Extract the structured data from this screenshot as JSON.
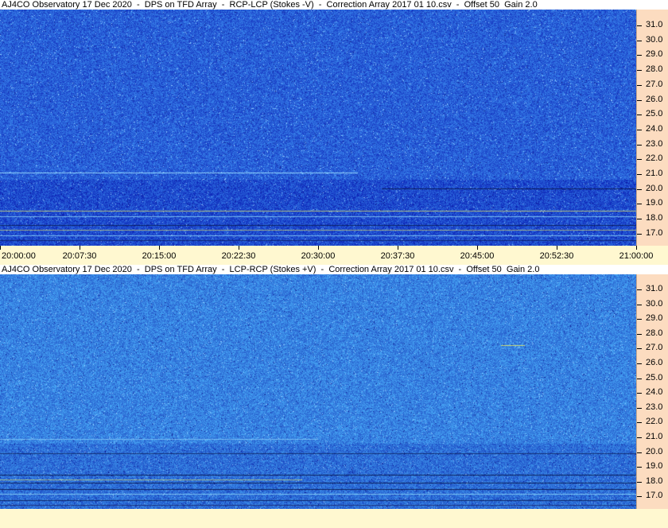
{
  "panels": [
    {
      "title": "AJ4CO Observatory 17 Dec 2020  -  DPS on TFD Array  -  RCP-LCP (Stokes -V)  -  Correction Array 2017 01 10.csv  -  Offset 50  Gain 2.0",
      "freq_labels": [
        "31.0",
        "30.0",
        "29.0",
        "28.0",
        "27.0",
        "26.0",
        "25.0",
        "24.0",
        "23.0",
        "22.0",
        "21.0",
        "20.0",
        "19.0",
        "18.0",
        "17.0"
      ]
    },
    {
      "title": "AJ4CO Observatory 17 Dec 2020  -  DPS on TFD Array  -  LCP-RCP (Stokes +V)  -  Correction Array 2017 01 10.csv  -  Offset 50  Gain 2.0",
      "freq_labels": [
        "31.0",
        "30.0",
        "29.0",
        "28.0",
        "27.0",
        "26.0",
        "25.0",
        "24.0",
        "23.0",
        "22.0",
        "21.0",
        "20.0",
        "19.0",
        "18.0",
        "17.0"
      ]
    }
  ],
  "time_axis": {
    "labels": [
      "20:00:00",
      "20:07:30",
      "20:15:00",
      "20:22:30",
      "20:30:00",
      "20:37:30",
      "20:45:00",
      "20:52:30",
      "21:00:00"
    ]
  },
  "colors": {
    "spectrogram_base_top": "#2f6ee0",
    "spectrogram_base_bottom": "#3a80e6",
    "freq_axis_bg": "#fcdcc0",
    "time_axis_bg": "#fff8d0"
  }
}
